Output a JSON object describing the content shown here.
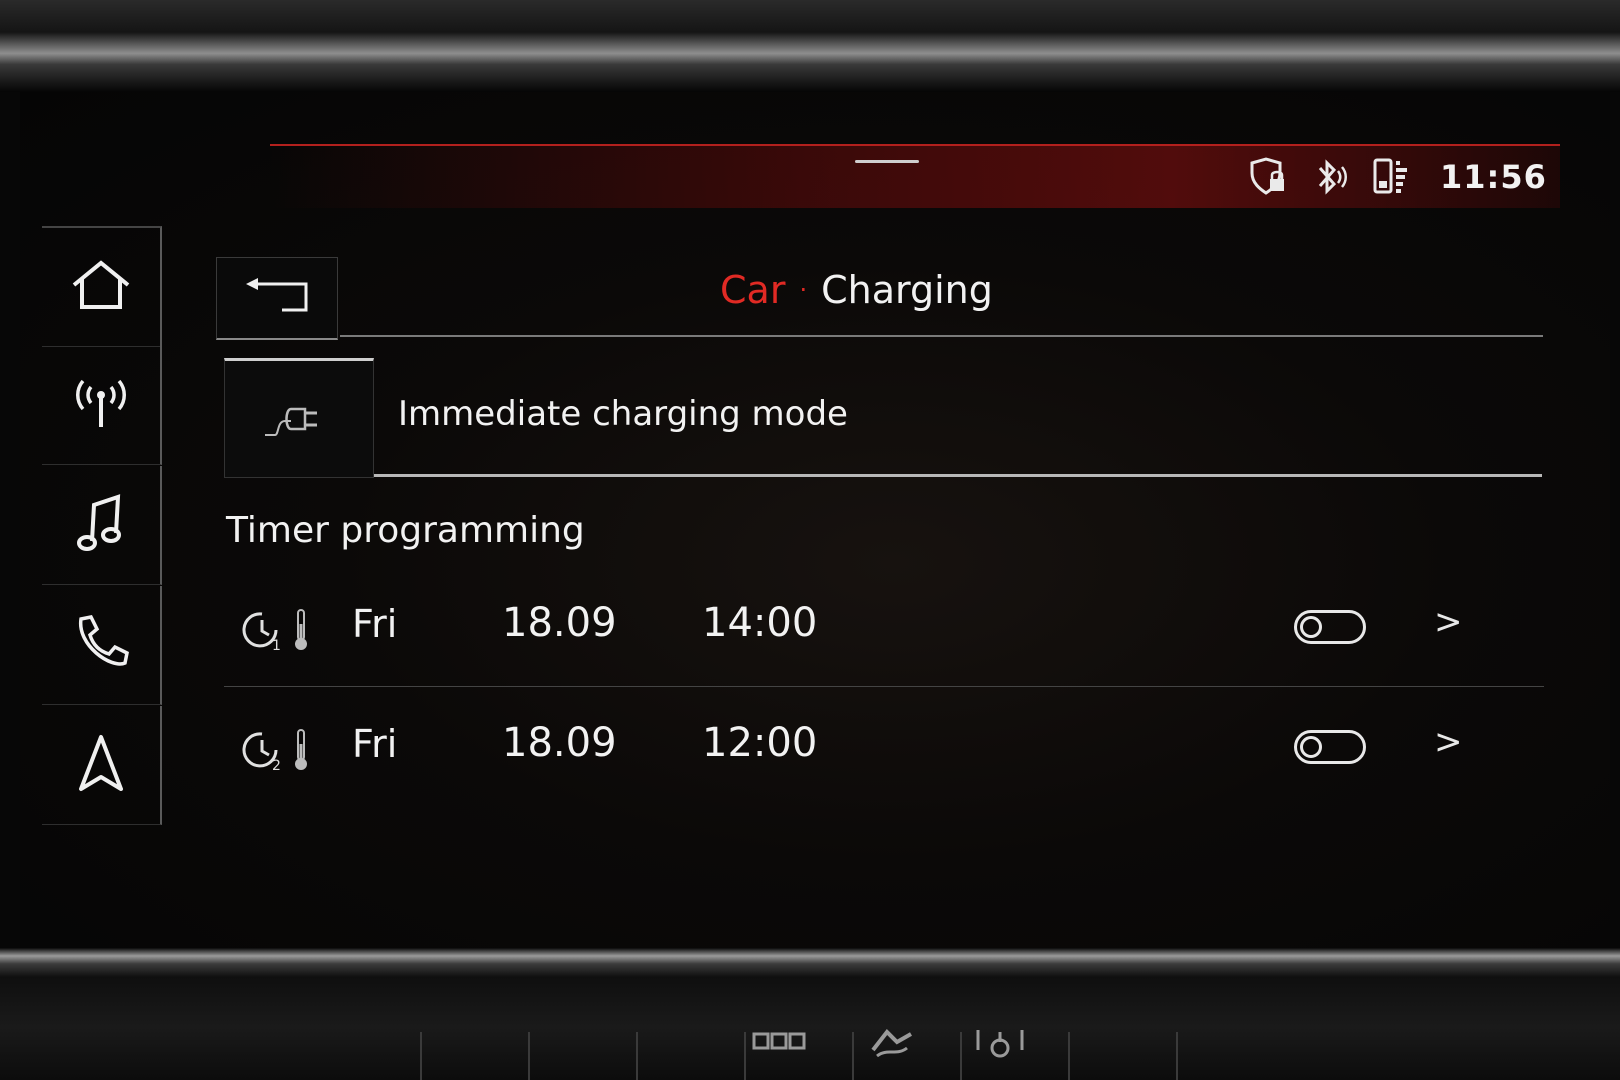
{
  "status_bar": {
    "time": "11:56",
    "icons": [
      "privacy-shield-lock-icon",
      "bluetooth-icon",
      "phone-battery-icon"
    ]
  },
  "nav": {
    "items": [
      {
        "name": "home",
        "icon": "home-icon"
      },
      {
        "name": "radio",
        "icon": "radio-antenna-icon"
      },
      {
        "name": "media",
        "icon": "music-note-icon"
      },
      {
        "name": "phone",
        "icon": "phone-icon"
      },
      {
        "name": "navigation",
        "icon": "navigation-arrow-icon"
      }
    ]
  },
  "header": {
    "breadcrumb_parent": "Car",
    "separator": "·",
    "breadcrumb_current": "Charging"
  },
  "immediate_charging": {
    "label": "Immediate charging mode",
    "icon": "charging-plug-icon"
  },
  "timer_section": {
    "title": "Timer programming",
    "timers": [
      {
        "number": "1",
        "day": "Fri",
        "date": "18.09",
        "time": "14:00",
        "enabled": false
      },
      {
        "number": "2",
        "day": "Fri",
        "date": "18.09",
        "time": "12:00",
        "enabled": false
      }
    ]
  },
  "colors": {
    "accent_red": "#e12a24",
    "text": "#f2f2f2",
    "background": "#070707"
  }
}
